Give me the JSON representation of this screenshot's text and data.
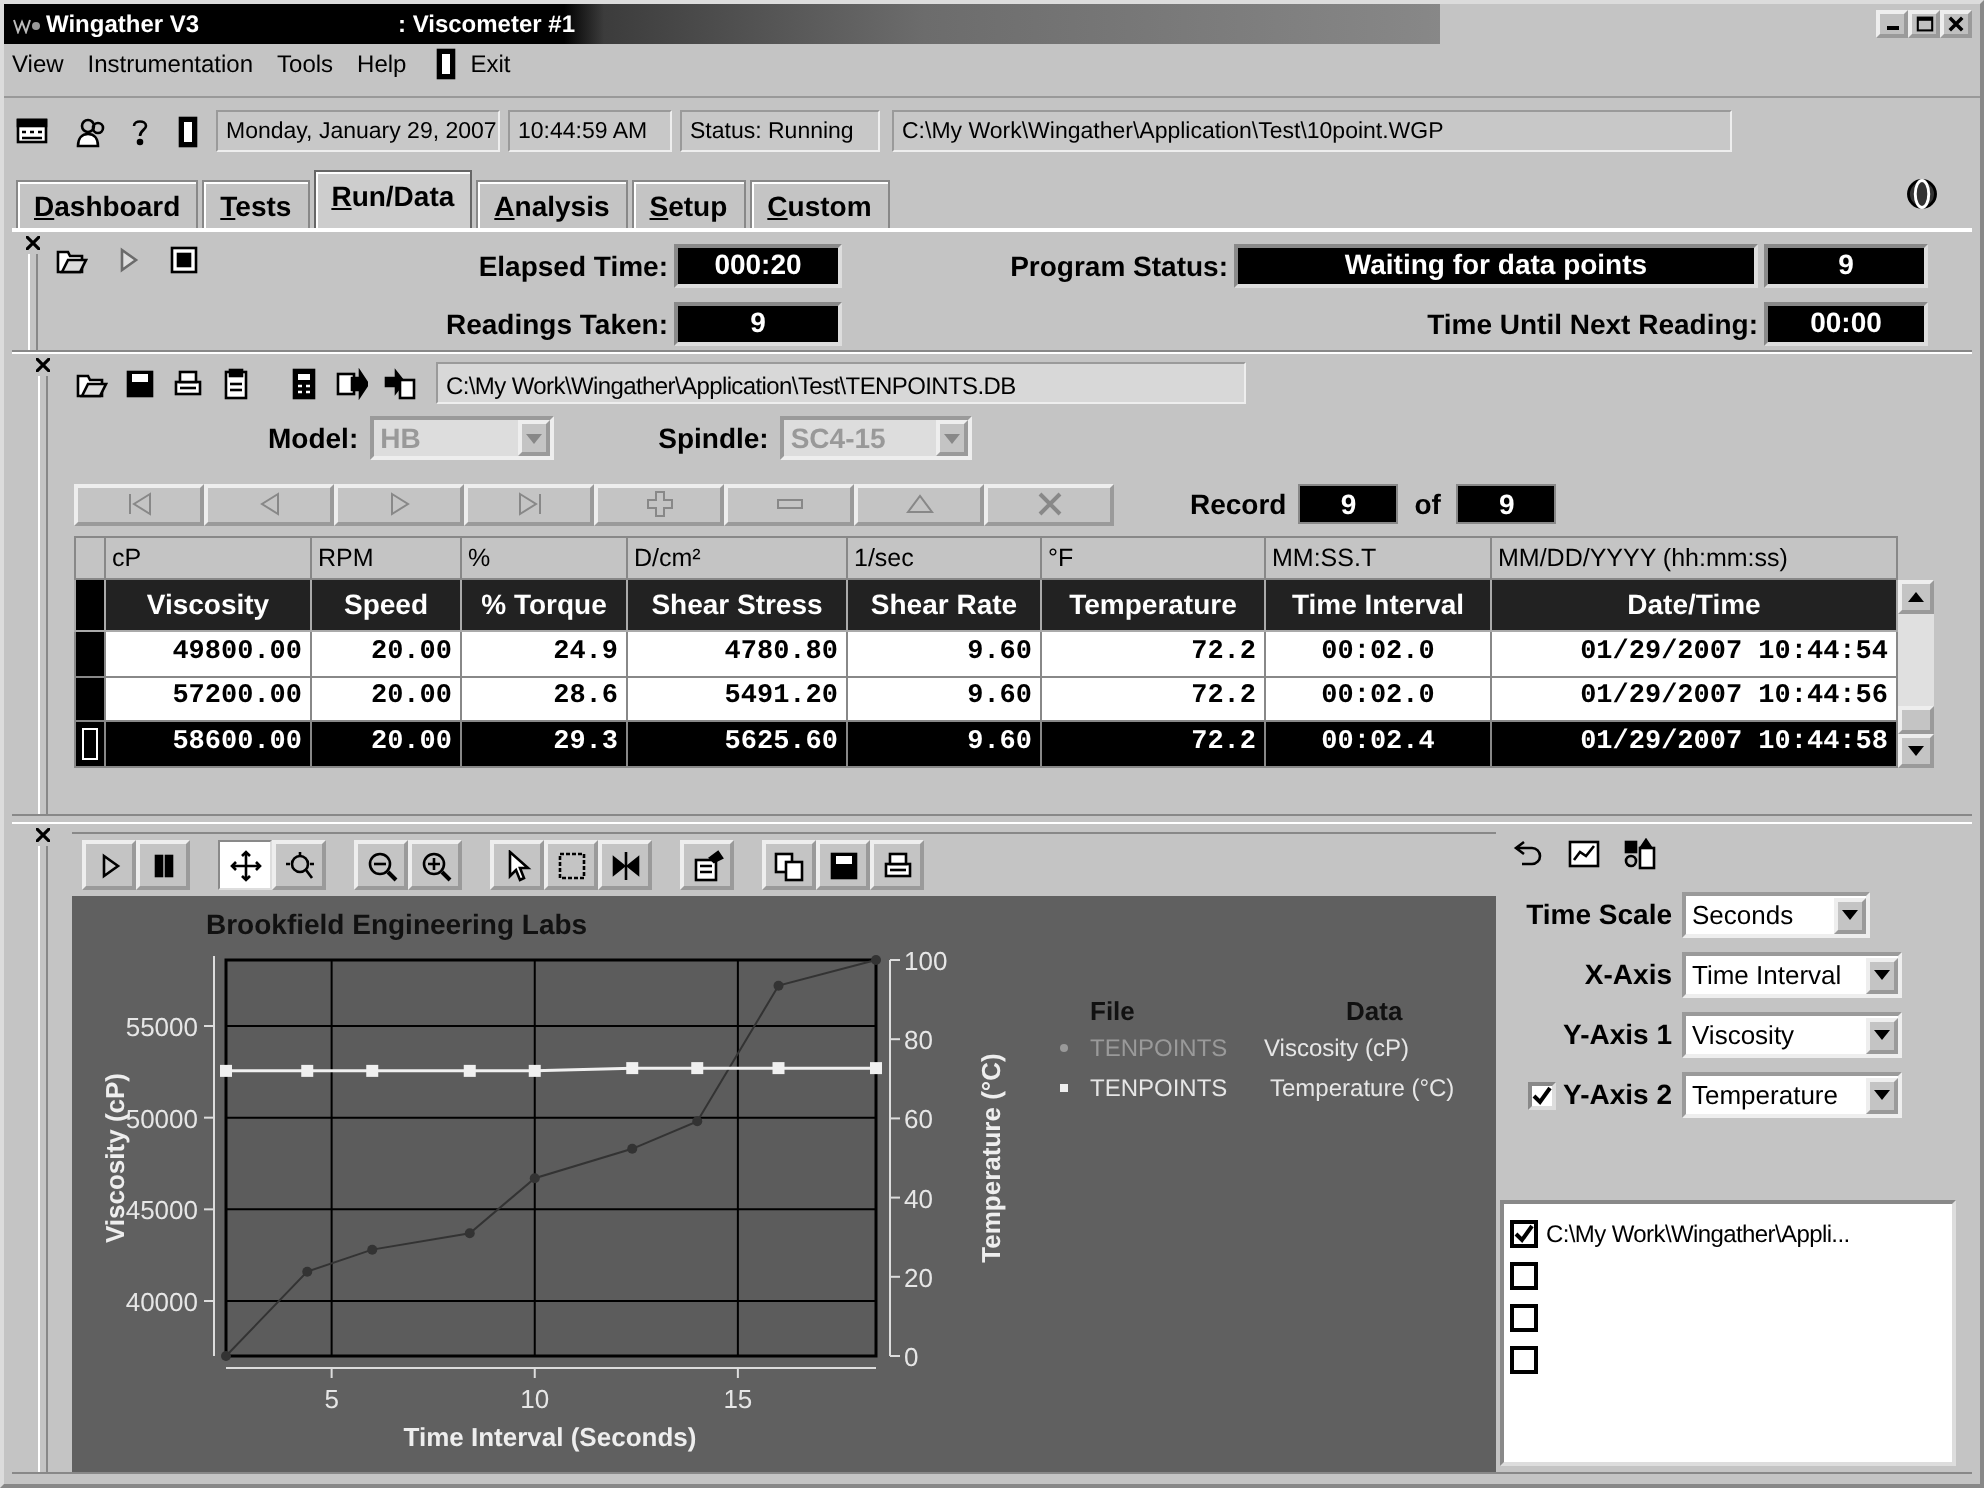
{
  "window": {
    "app_title": "Wingather V3",
    "doc_title": ": Viscometer #1"
  },
  "menu": [
    {
      "label": "View",
      "kind": "plain"
    },
    {
      "label": "Instrumentation",
      "kind": "plain"
    },
    {
      "label": "Tools",
      "kind": "plain"
    },
    {
      "label": "Help",
      "kind": "plain"
    },
    {
      "label": "Exit",
      "kind": "exit"
    }
  ],
  "toolbar_fields": [
    "Monday, January 29, 2007",
    "10:44:59 AM",
    "Status: Running",
    "C:\\My Work\\Wingather\\Application\\Test\\10point.WGP"
  ],
  "tabs": [
    {
      "label": "Dashboard",
      "selected": false
    },
    {
      "label": "Tests",
      "selected": false
    },
    {
      "label": "Run/Data",
      "selected": true
    },
    {
      "label": "Analysis",
      "selected": false
    },
    {
      "label": "Setup",
      "selected": false
    },
    {
      "label": "Custom",
      "selected": false
    }
  ],
  "run_panel": {
    "controls": [
      {
        "kind": "open",
        "disabled": false
      },
      {
        "kind": "play",
        "disabled": true
      },
      {
        "kind": "stop",
        "disabled": false
      }
    ],
    "elapsed_label": "Elapsed Time:",
    "elapsed": "000:20",
    "readings_label": "Readings Taken:",
    "readings": "9",
    "status_label": "Program Status:",
    "status": "Waiting for data points",
    "status_count": "9",
    "next_label": "Time Until Next Reading:",
    "next": "00:00"
  },
  "data_panel": {
    "file_path": "C:\\My Work\\Wingather\\Application\\Test\\TENPOINTS.DB",
    "model": {
      "label": "Model:",
      "value": "HB",
      "disabled": true
    },
    "spindle": {
      "label": "Spindle:",
      "value": "SC4-15",
      "disabled": true
    },
    "record_buttons": [
      {
        "kind": "first",
        "disabled": true
      },
      {
        "kind": "prior",
        "disabled": true
      },
      {
        "kind": "next",
        "disabled": true
      },
      {
        "kind": "last",
        "disabled": true
      },
      {
        "kind": "insert",
        "disabled": true
      },
      {
        "kind": "delete",
        "disabled": true
      },
      {
        "kind": "post",
        "disabled": true
      },
      {
        "kind": "cancel",
        "disabled": true
      }
    ],
    "record_label": "Record",
    "record": "9",
    "of_label": "of",
    "record_total": "9",
    "table": {
      "units": [
        "cP",
        "RPM",
        "%",
        "D/cm²",
        "1/sec",
        "°F",
        "MM:SS.T",
        "MM/DD/YYYY (hh:mm:ss)"
      ],
      "columns": [
        "Viscosity",
        "Speed",
        "% Torque",
        "Shear Stress",
        "Shear Rate",
        "Temperature",
        "Time Interval",
        "Date/Time"
      ],
      "rows": [
        {
          "selected": false,
          "cells": [
            "49800.00",
            "20.00",
            "24.9",
            "4780.80",
            "9.60",
            "72.2",
            "00:02.0",
            "01/29/2007 10:44:54"
          ]
        },
        {
          "selected": false,
          "cells": [
            "57200.00",
            "20.00",
            "28.6",
            "5491.20",
            "9.60",
            "72.2",
            "00:02.0",
            "01/29/2007 10:44:56"
          ]
        },
        {
          "selected": true,
          "cells": [
            "58600.00",
            "20.00",
            "29.3",
            "5625.60",
            "9.60",
            "72.2",
            "00:02.4",
            "01/29/2007 10:44:58"
          ]
        }
      ]
    }
  },
  "chart_panel": {
    "tools": [
      {
        "kind": "play",
        "pressed": false
      },
      {
        "kind": "pause",
        "pressed": false
      },
      {
        "kind": "pan",
        "pressed": true
      },
      {
        "kind": "zoom-area",
        "pressed": false
      },
      {
        "kind": "zoom-out",
        "pressed": false
      },
      {
        "kind": "zoom-in",
        "pressed": false
      },
      {
        "kind": "pointer",
        "pressed": false
      },
      {
        "kind": "select-rect",
        "pressed": false
      },
      {
        "kind": "mirror",
        "pressed": false
      },
      {
        "kind": "properties",
        "pressed": false
      },
      {
        "kind": "copy",
        "pressed": false
      },
      {
        "kind": "save",
        "pressed": false
      },
      {
        "kind": "print",
        "pressed": false
      }
    ],
    "chart_data": {
      "type": "line",
      "grid": true,
      "title": "Brookfield Engineering Labs",
      "xlabel": "Time Interval (Seconds)",
      "ylabel": "Viscosity (cP)",
      "y2label": "Temperature (°C)",
      "x": [
        2.4,
        4.4,
        6.0,
        8.4,
        10.0,
        12.4,
        14.0,
        16.0,
        18.4
      ],
      "xlim": [
        2.4,
        18.4
      ],
      "ylim": [
        37000,
        58600
      ],
      "y2lim": [
        0,
        100
      ],
      "xticks": [
        5,
        10,
        15
      ],
      "yticks": [
        40000,
        45000,
        50000,
        55000
      ],
      "y2ticks": [
        0,
        20,
        40,
        60,
        80,
        100
      ],
      "series": [
        {
          "name": "Viscosity (cP)",
          "color": "#333333",
          "axis": "y",
          "marker": "circle",
          "values": [
            37000,
            41600,
            42800,
            43700,
            46700,
            48300,
            49800,
            57200,
            58600
          ]
        },
        {
          "name": "Temperature (°C)",
          "color": "#f0f0f0",
          "axis": "y2",
          "marker": "square",
          "values": [
            72.0,
            72.0,
            72.0,
            72.0,
            72.0,
            72.7,
            72.7,
            72.7,
            72.7
          ]
        }
      ]
    },
    "legend": {
      "file_header": "File",
      "data_header": "Data",
      "rows": [
        {
          "file": "TENPOINTS"
        },
        {
          "file": "TENPOINTS"
        }
      ]
    },
    "settings": [
      {
        "kind": "plain",
        "label": "Time Scale",
        "value": "Seconds"
      },
      {
        "kind": "plain",
        "label": "X-Axis",
        "value": "Time Interval"
      },
      {
        "kind": "plain",
        "label": "Y-Axis 1",
        "value": "Viscosity"
      },
      {
        "kind": "checkbox",
        "label": "Y-Axis 2",
        "value": "Temperature",
        "checked": true
      }
    ],
    "files": [
      {
        "label": "C:\\My Work\\Wingather\\Appli...",
        "checked": true
      },
      {
        "checked": false
      },
      {
        "checked": false
      },
      {
        "checked": false
      }
    ]
  }
}
